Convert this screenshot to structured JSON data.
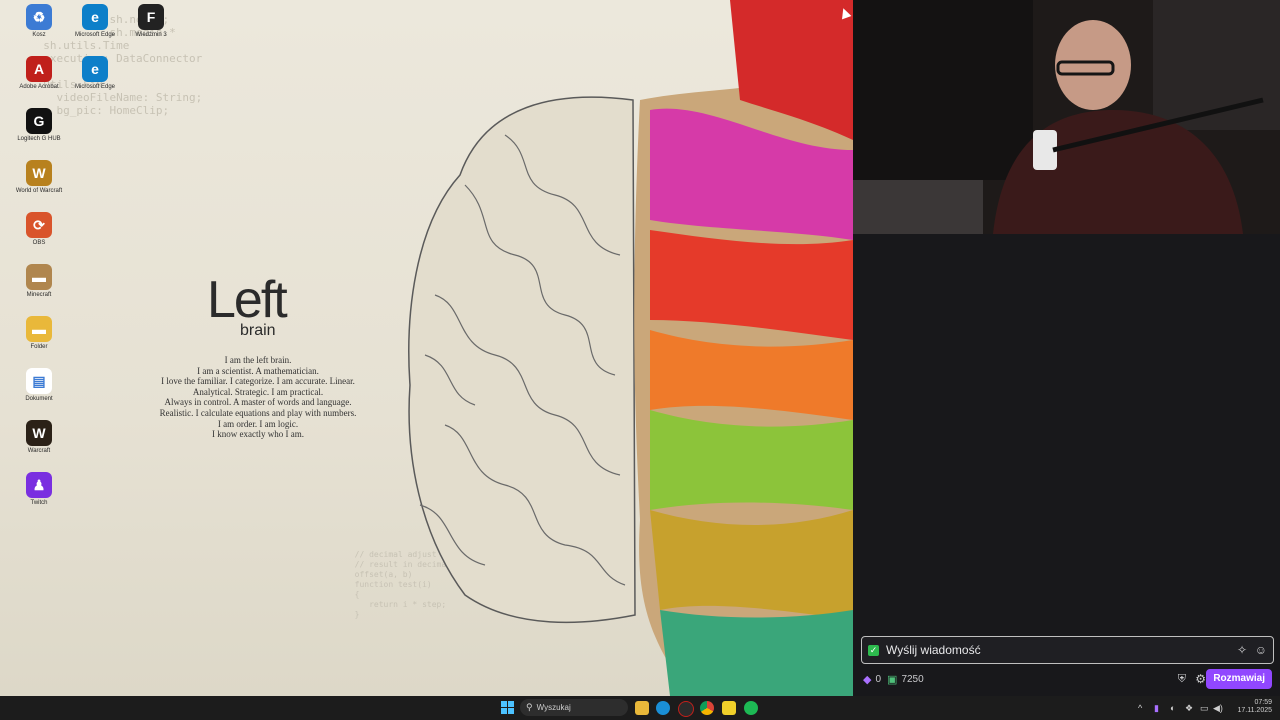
{
  "desktop": {
    "icons": [
      {
        "name": "Kosz",
        "color": "#3c7bd4",
        "glyph": "♻"
      },
      {
        "name": "Microsoft Edge",
        "color": "#0d7fc9",
        "glyph": "e"
      },
      {
        "name": "Wiedźmin 3",
        "color": "#222222",
        "glyph": "F"
      },
      {
        "name": "Adobe Acrobat",
        "color": "#c0201b",
        "glyph": "A"
      },
      {
        "name": "Microsoft Edge",
        "color": "#0d7fc9",
        "glyph": "e"
      },
      {
        "name": "Logitech G HUB",
        "color": "#111111",
        "glyph": "G"
      },
      {
        "name": "World of Warcraft",
        "color": "#b8811e",
        "glyph": "W"
      },
      {
        "name": "OBS",
        "color": "#d9542b",
        "glyph": "⟳"
      },
      {
        "name": "Minecraft",
        "color": "#b0864e",
        "glyph": "▬"
      },
      {
        "name": "Folder",
        "color": "#e9b83a",
        "glyph": "▬"
      },
      {
        "name": "Dokument",
        "color": "#ffffff",
        "glyph": "▤"
      },
      {
        "name": "Warcraft",
        "color": "#2b2117",
        "glyph": "W"
      },
      {
        "name": "Twitch",
        "color": "#7a2fe0",
        "glyph": "♟"
      }
    ],
    "wallpaper": {
      "title": "Left",
      "subtitle": "brain",
      "lines": [
        "I am the left brain.",
        "I am a scientist. A mathematician.",
        "I love the familiar. I categorize. I am accurate. Linear.",
        "Analytical. Strategic. I am practical.",
        "Always in control. A master of words and language.",
        "Realistic. I calculate equations and play with numbers.",
        "I am order. I am logic.",
        "I know exactly who I am."
      ]
    }
  },
  "chat": {
    "input_placeholder": "Wyślij wiadomość",
    "points_left": "0",
    "points_right": "7250",
    "send_label": "Rozmawiaj"
  },
  "taskbar": {
    "search_placeholder": "Wyszukaj",
    "time": "07:59",
    "date": "17.11.2025"
  }
}
